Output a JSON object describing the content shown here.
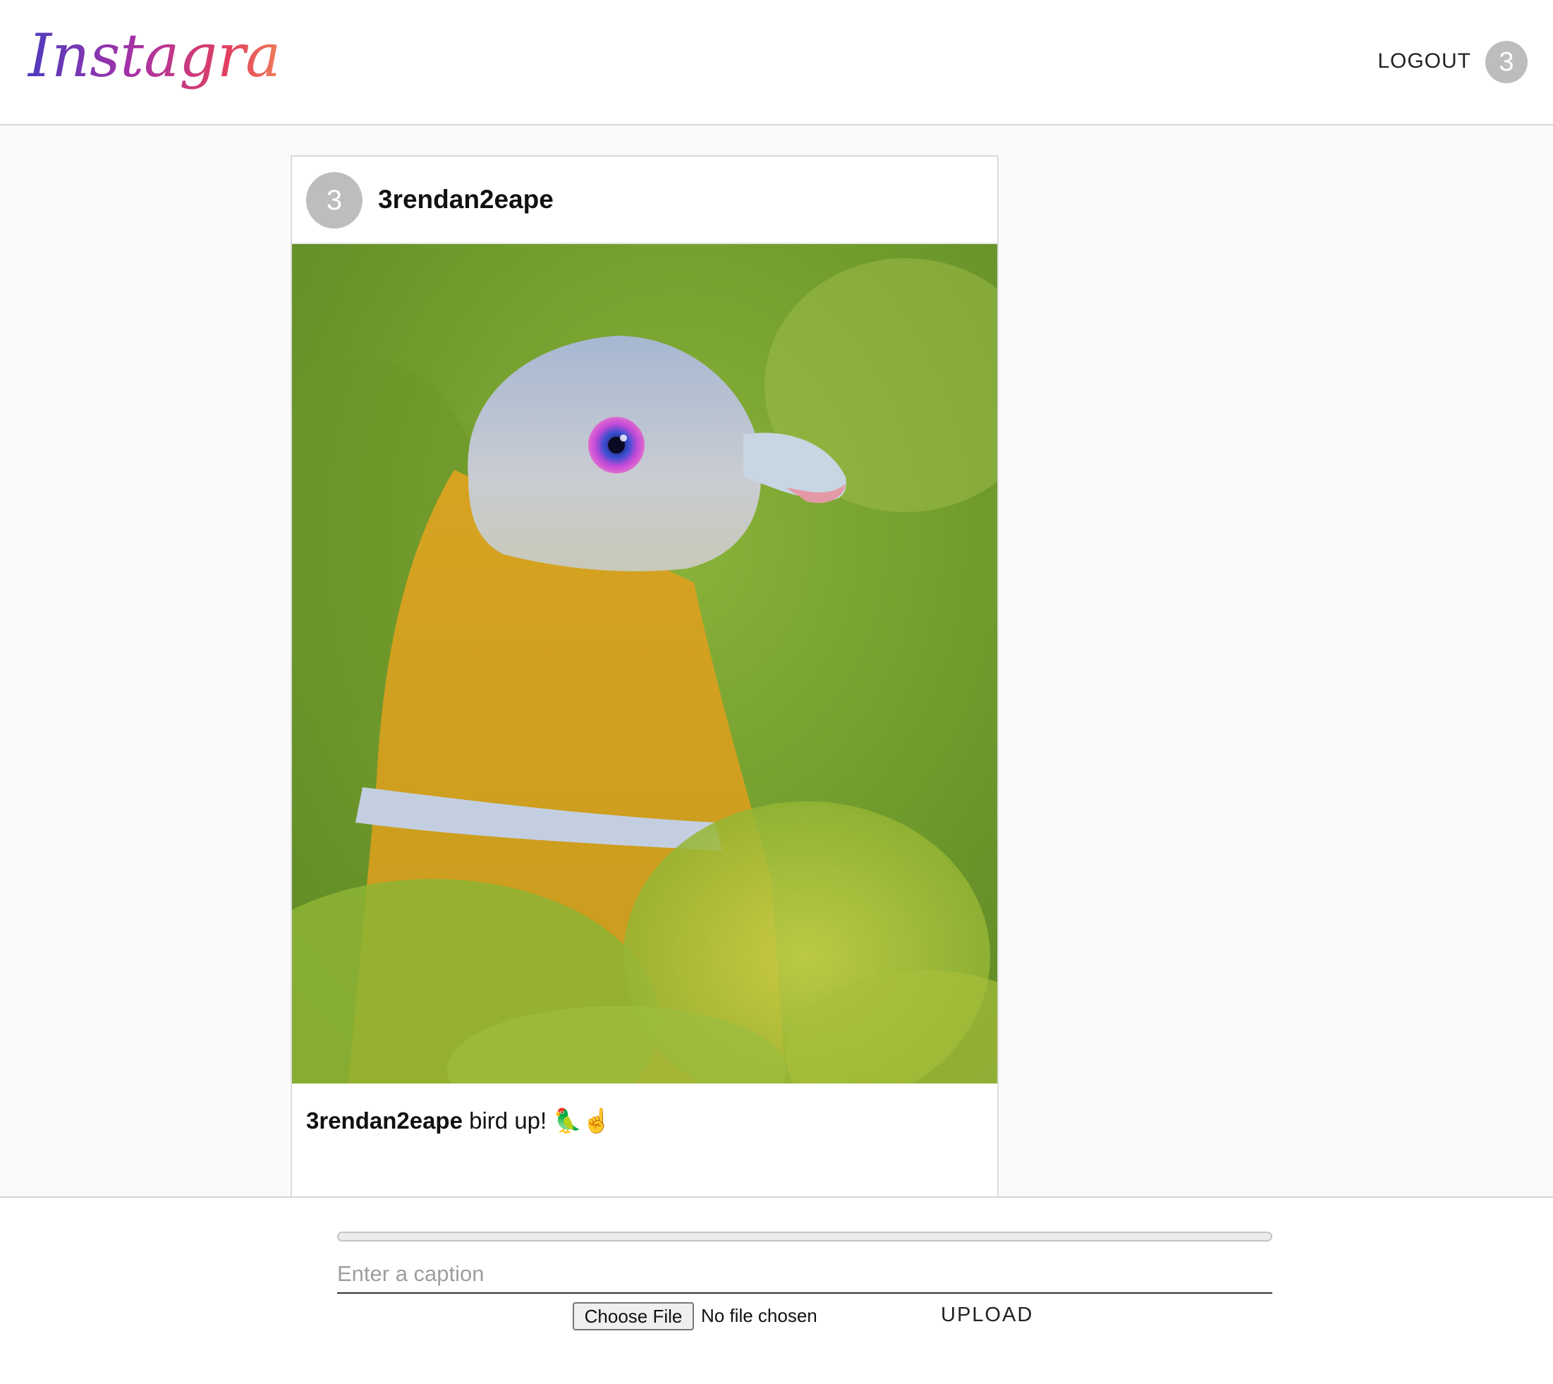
{
  "header": {
    "logo_text": "Instagram",
    "logout_label": "LOGOUT",
    "avatar_initial": "3"
  },
  "post": {
    "avatar_initial": "3",
    "username": "3rendan2eape",
    "caption_username": "3rendan2eape",
    "caption_text": "bird up! 🦜☝️"
  },
  "upload": {
    "progress": 0,
    "caption_placeholder": "Enter a caption",
    "caption_value": "",
    "choose_file_label": "Choose File",
    "file_status": "No file chosen",
    "upload_label": "UPLOAD"
  }
}
